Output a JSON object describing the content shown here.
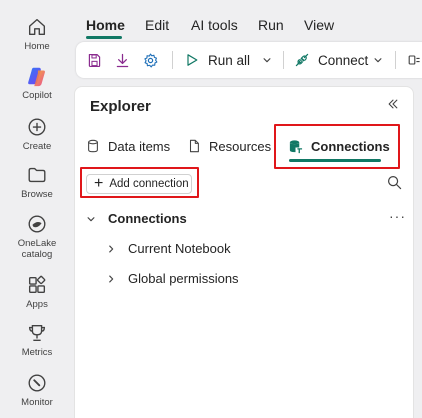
{
  "rail": {
    "items": [
      {
        "label": "Home",
        "icon": "home-icon"
      },
      {
        "label": "Copilot",
        "icon": "copilot-icon"
      },
      {
        "label": "Create",
        "icon": "plus-circle-icon"
      },
      {
        "label": "Browse",
        "icon": "folder-icon"
      },
      {
        "label_line1": "OneLake",
        "label_line2": "catalog",
        "icon": "onelake-icon"
      },
      {
        "label": "Apps",
        "icon": "apps-icon"
      },
      {
        "label": "Metrics",
        "icon": "trophy-icon"
      },
      {
        "label": "Monitor",
        "icon": "monitor-icon"
      }
    ]
  },
  "menu": {
    "tabs": [
      "Home",
      "Edit",
      "AI tools",
      "Run",
      "View"
    ],
    "active": "Home"
  },
  "toolbar": {
    "run_all_label": "Run all",
    "connect_label": "Connect"
  },
  "explorer": {
    "title": "Explorer",
    "tabs": [
      "Data items",
      "Resources",
      "Connections"
    ],
    "active_tab": "Connections",
    "add_connection_label": "Add connection",
    "section_label": "Connections",
    "children": [
      "Current Notebook",
      "Global permissions"
    ],
    "more_label": "···"
  },
  "colors": {
    "accent": "#117865",
    "highlight": "#e0161a",
    "background": "#efeff1"
  }
}
